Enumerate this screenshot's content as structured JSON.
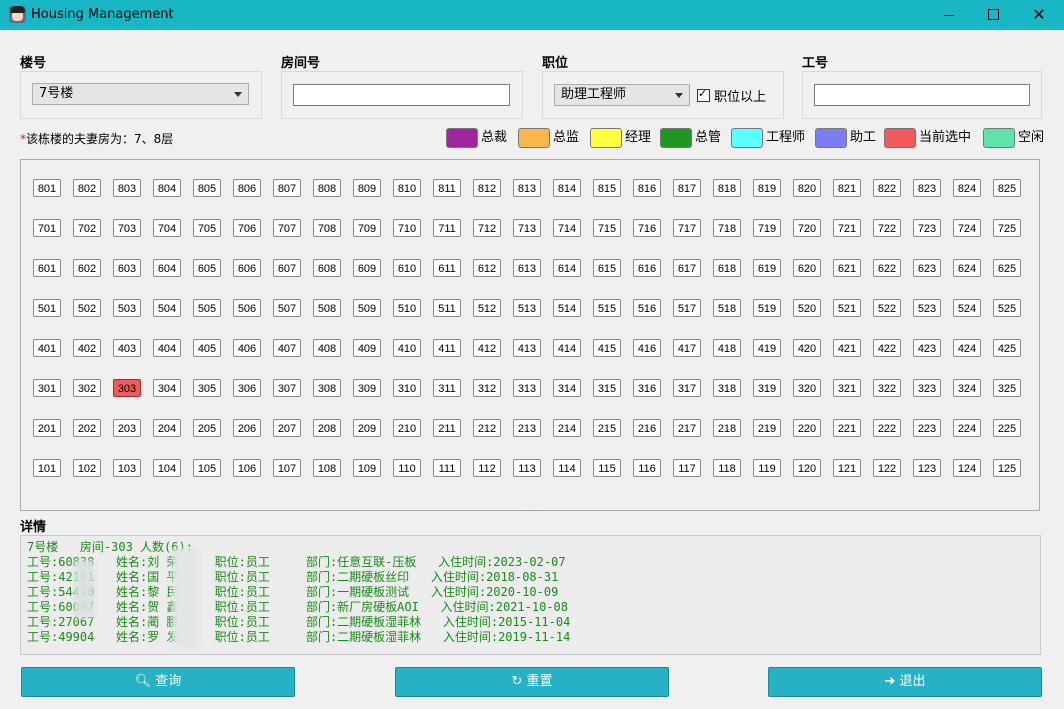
{
  "window": {
    "title": "Housing Management",
    "controls": {
      "minimize": "—",
      "maximize": "☐",
      "close": "✕"
    }
  },
  "filters": {
    "building_label": "楼号",
    "building_value": "7号楼",
    "room_label": "房间号",
    "room_value": "",
    "position_label": "职位",
    "position_value": "助理工程师",
    "above_position_label": "职位以上",
    "above_position_checked": true,
    "employee_id_label": "工号",
    "employee_id_value": ""
  },
  "note": {
    "star": "*",
    "text": "该栋楼的夫妻房为：7、8层"
  },
  "legend": [
    {
      "label": "总裁",
      "color": "#a0269f"
    },
    {
      "label": "总监",
      "color": "#f9b64e"
    },
    {
      "label": "经理",
      "color": "#ffff40"
    },
    {
      "label": "总管",
      "color": "#229622"
    },
    {
      "label": "工程师",
      "color": "#5affff"
    },
    {
      "label": "助工",
      "color": "#7a7cf0"
    },
    {
      "label": "当前选中",
      "color": "#f05a5a"
    },
    {
      "label": "空闲",
      "color": "#5ee3a8"
    }
  ],
  "rooms": {
    "floors": [
      8,
      7,
      6,
      5,
      4,
      3,
      2,
      1
    ],
    "rooms_per_floor": 25,
    "selected": "303"
  },
  "details": {
    "label": "详情",
    "lines": [
      "7号楼   房间-303 人数(6):",
      "工号:60838   姓名:刘 荣     职位:员工     部门:任意互联-压板   入住时间:2023-02-07",
      "工号:42181   姓名:国 平     职位:员工     部门:二期硬板丝印   入住时间:2018-08-31",
      "工号:54410   姓名:黎 民     职位:员工     部门:一期硬板测试   入住时间:2020-10-09",
      "工号:60007   姓名:贺 鑫     职位:员工     部门:新厂房硬板AOI   入住时间:2021-10-08",
      "工号:27067   姓名:蔺 鹏     职位:员工     部门:二期硬板湿菲林   入住时间:2015-11-04",
      "工号:49904   姓名:罗 发     职位:员工     部门:二期硬板湿菲林   入住时间:2019-11-14"
    ]
  },
  "buttons": {
    "query": {
      "label": "查询",
      "icon": "search-icon"
    },
    "reset": {
      "label": "重置",
      "icon": "refresh-icon"
    },
    "exit": {
      "label": "退出",
      "icon": "exit-icon"
    }
  }
}
